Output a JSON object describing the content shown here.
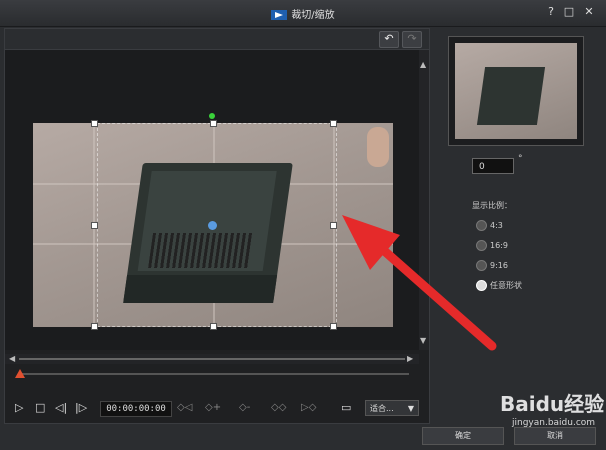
{
  "window": {
    "title": "裁切/缩放",
    "help_icon": "?",
    "max_icon": "□",
    "close_icon": "✕"
  },
  "toolbar": {
    "undo_glyph": "↶",
    "redo_glyph": "↷"
  },
  "player": {
    "timecode": "00:00:00:00",
    "fit_label": "适合...",
    "fit_caret": "▼"
  },
  "side": {
    "angle_value": "0",
    "degree_symbol": "°",
    "ratio_label": "显示比例：",
    "ratios": [
      {
        "label": "4:3",
        "selected": false
      },
      {
        "label": "16:9",
        "selected": false
      },
      {
        "label": "9:16",
        "selected": false
      },
      {
        "label": "任意形状",
        "selected": true
      }
    ]
  },
  "footer": {
    "ok_label": "确定",
    "cancel_label": "取消"
  },
  "watermark": {
    "brand": "Baidu经验",
    "url": "jingyan.baidu.com"
  },
  "colors": {
    "annotation_arrow": "#e52a2a",
    "rotate_handle": "#3ad13a",
    "center_point": "#5a9be0"
  }
}
